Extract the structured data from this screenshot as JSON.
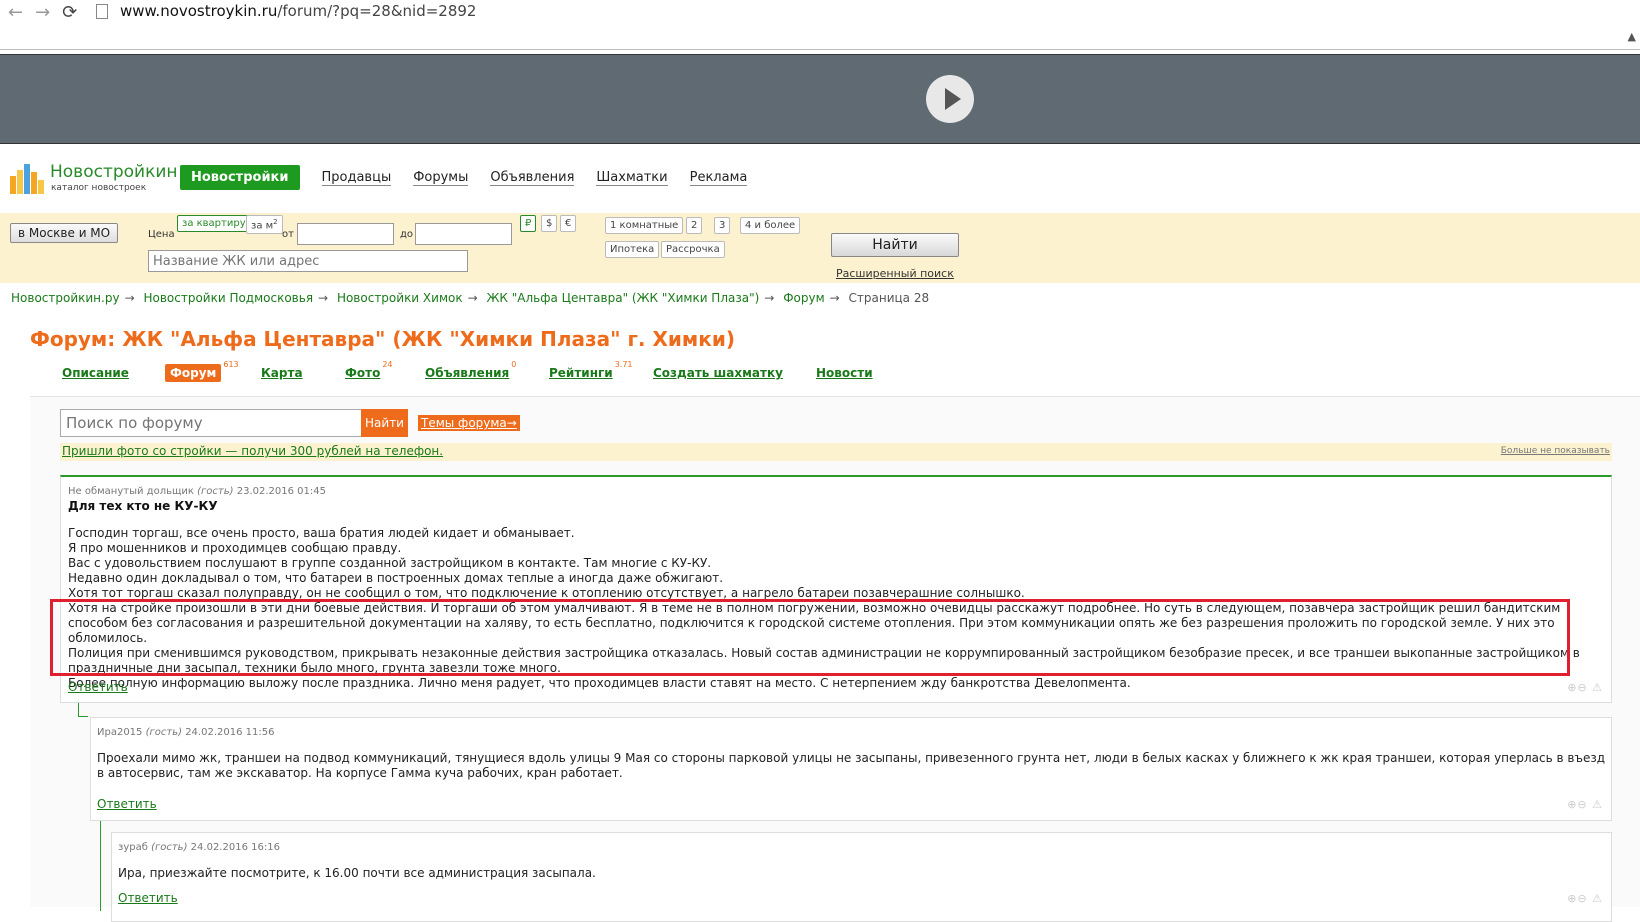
{
  "browser": {
    "url_host": "www.novostroykin.ru",
    "url_path": "/forum/?pq=28&nid=2892"
  },
  "site": {
    "logo_title": "Новостройкин",
    "logo_sub": "каталог новостроек",
    "nav": [
      "Новостройки",
      "Продавцы",
      "Форумы",
      "Объявления",
      "Шахматки",
      "Реклама"
    ]
  },
  "search": {
    "region": "в Москве и МО",
    "price_label": "Цена",
    "per_flat": "за квартиру",
    "per_m2": "за м",
    "from": "от",
    "to": "до",
    "currencies": [
      "₽",
      "$",
      "€"
    ],
    "rooms": [
      "1 комнатные",
      "2",
      "3",
      "4 и более"
    ],
    "extra": [
      "Ипотека",
      "Рассрочка"
    ],
    "name_placeholder": "Название ЖК или адрес",
    "find": "Найти",
    "advanced": "Расширенный поиск"
  },
  "breadcrumbs": [
    "Новостройкин.ру",
    "Новостройки Подмосковья",
    "Новостройки Химок",
    "ЖК \"Альфа Центавра\" (ЖК \"Химки Плаза\")",
    "Форум"
  ],
  "breadcrumb_current": "Страница 28",
  "page_title": "Форум: ЖК \"Альфа Центавра\" (ЖК \"Химки Плаза\" г. Химки)",
  "tabs": [
    {
      "label": "Описание",
      "count": ""
    },
    {
      "label": "Форум",
      "count": "613"
    },
    {
      "label": "Карта",
      "count": ""
    },
    {
      "label": "Фото",
      "count": "24"
    },
    {
      "label": "Объявления",
      "count": "0"
    },
    {
      "label": "Рейтинги",
      "count": "3.71"
    },
    {
      "label": "Создать шахматку",
      "count": ""
    },
    {
      "label": "Новости",
      "count": ""
    }
  ],
  "forum": {
    "search_placeholder": "Поиск по форуму",
    "find": "Найти",
    "themes": "Темы форума→",
    "promo": "Пришли фото со стройки — получи 300 рублей на телефон.",
    "promo_hide": "Больше не показывать",
    "reply": "Ответить"
  },
  "posts": [
    {
      "author": "Не обманутый дольщик",
      "role": "(гость)",
      "date": "23.02.2016 01:45",
      "subject": "Для тех кто не КУ-КУ",
      "lines": [
        "Господин торгаш, все очень просто, ваша братия людей кидает и обманывает.",
        "Я про мошенников и проходимцев сообщаю правду.",
        "Вас с удовольствием послушают в группе созданной застройщиком в контакте. Там многие с КУ-КУ.",
        "Недавно один докладывал о том, что батареи в построенных домах теплые а иногда даже обжигают.",
        "Хотя тот торгаш сказал полуправду, он не сообщил о том, что подключение к отоплению отсутствует, а нагрело батареи позавчерашние солнышко.",
        "Хотя на стройке произошли в эти дни боевые действия. И торгаши об этом умалчивают. Я в теме не в полном погружении, возможно очевидцы расскажут подробнее. Но суть в следующем, позавчера застройщик решил бандитским способом без согласования и разрешительной документации на халяву, то есть бесплатно, подключится к городской системе отопления. При этом коммуникации опять же без разрешения проложить по городской земле. У них это обломилось.",
        "Полиция при сменившимся руководством, прикрывать незаконные действия застройщика отказалась. Новый состав администрации не коррумпированный застройщиком безобразие пресек, и все траншеи выкопанные застройщиком в праздничные дни засыпал, техники было много, грунта завезли тоже много.",
        "Более полную информацию выложу после праздника. Лично меня радует, что проходимцев власти ставят на место. С нетерпением жду банкротства Девелопмента."
      ]
    },
    {
      "author": "Ира2015",
      "role": "(гость)",
      "date": "24.02.2016 11:56",
      "lines": [
        "Проехали мимо жк, траншеи на подвод коммуникаций, тянущиеся вдоль улицы 9 Мая со стороны парковой улицы не засыпаны, привезенного грунта нет, люди в белых касках у ближнего к жк края траншеи, которая уперлась в въезд в автосервис, там же экскаватор. На корпусе Гамма куча рабочих, кран работает."
      ]
    },
    {
      "author": "зураб",
      "role": "(гость)",
      "date": "24.02.2016 16:16",
      "lines": [
        "Ира, приезжайте посмотрите, к 16.00 почти все администрация засыпала."
      ]
    }
  ],
  "colors": {
    "accent_orange": "#ee6b1c",
    "link_green": "#1a7a1a",
    "highlight_red": "#e0202e"
  }
}
